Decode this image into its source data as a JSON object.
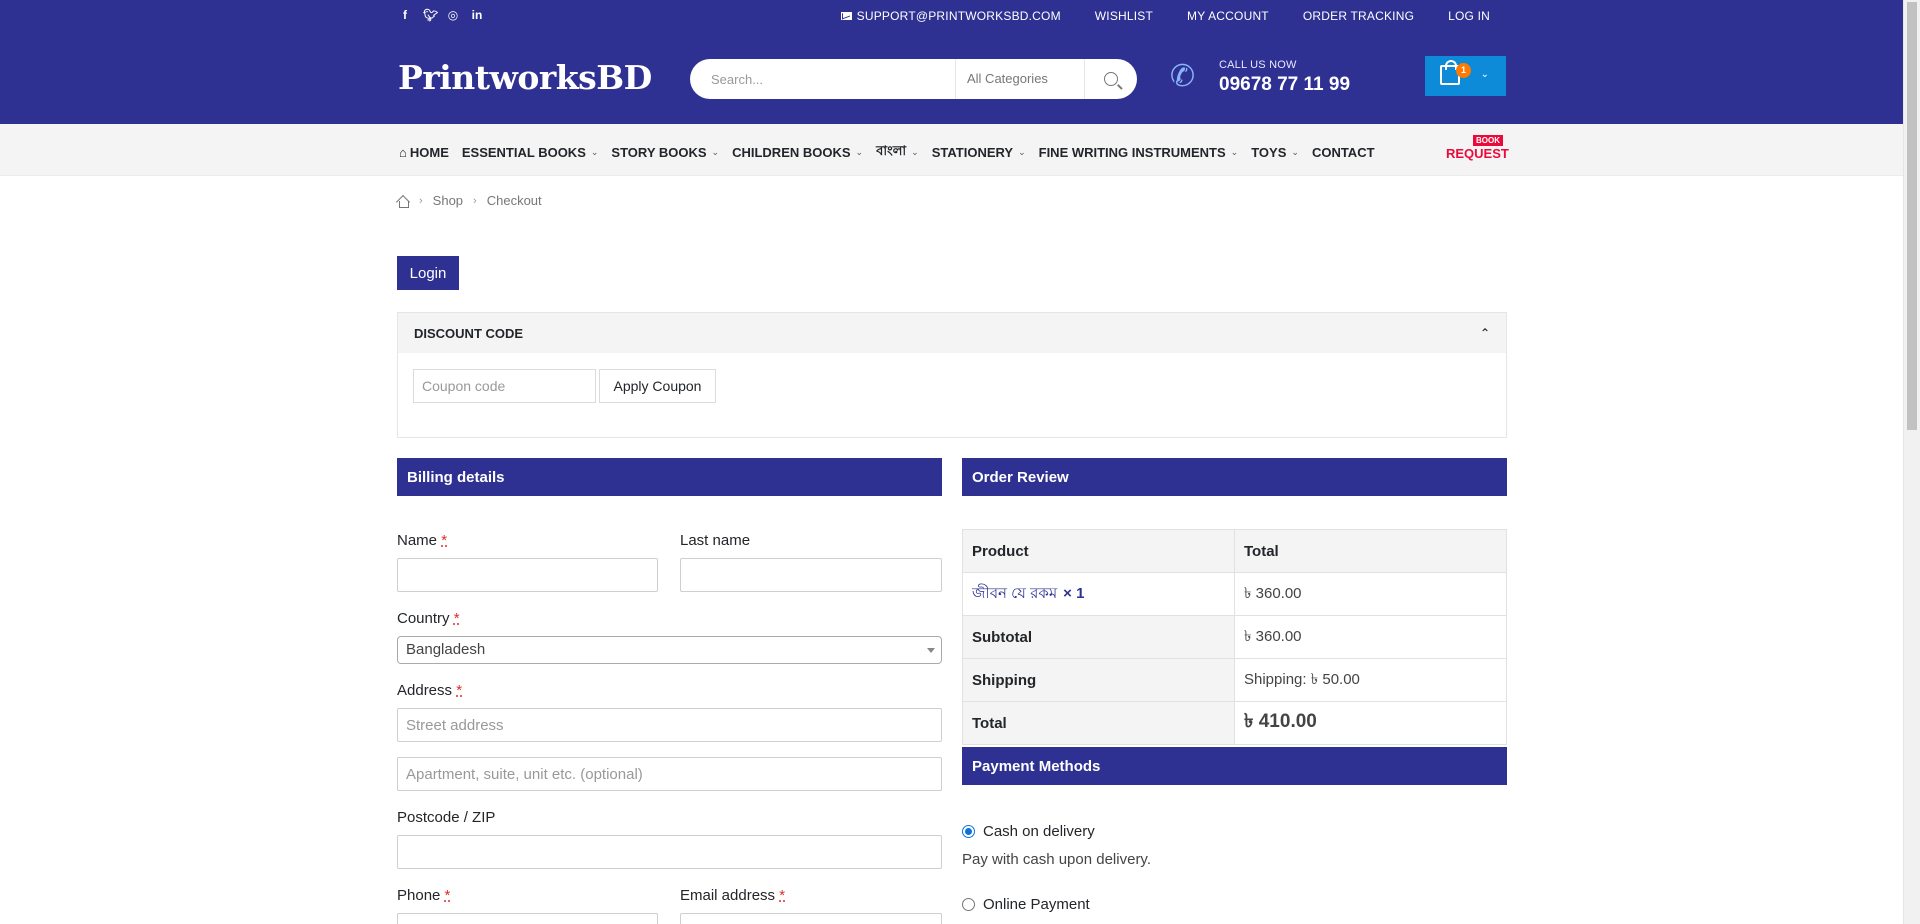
{
  "topbar": {
    "social": [
      "facebook-icon",
      "twitter-icon",
      "instagram-icon",
      "linkedin-icon"
    ],
    "email": "SUPPORT@PRINTWORKSBD.COM",
    "wishlist": "WISHLIST",
    "account": "MY ACCOUNT",
    "tracking": "ORDER TRACKING",
    "login": "LOG IN"
  },
  "header": {
    "logo": "PrintworksBD",
    "search_placeholder": "Search...",
    "category": "All Categories",
    "call_label": "CALL US NOW",
    "call_number": "09678 77 11 99",
    "cart_count": "1"
  },
  "nav": {
    "home": "HOME",
    "essential": "ESSENTIAL BOOKS",
    "story": "STORY BOOKS",
    "children": "CHILDREN BOOKS",
    "bangla": "বাংলা",
    "stationery": "STATIONERY",
    "writing": "FINE WRITING INSTRUMENTS",
    "toys": "TOYS",
    "contact": "CONTACT",
    "request_badge": "BOOK",
    "request": "REQUEST"
  },
  "breadcrumb": {
    "shop": "Shop",
    "checkout": "Checkout"
  },
  "login_button": "Login",
  "discount": {
    "title": "DISCOUNT CODE",
    "placeholder": "Coupon code",
    "apply": "Apply Coupon"
  },
  "billing": {
    "title": "Billing details",
    "name_label": "Name",
    "lastname_label": "Last name",
    "country_label": "Country",
    "country_value": "Bangladesh",
    "address_label": "Address",
    "street_placeholder": "Street address",
    "apt_placeholder": "Apartment, suite, unit etc. (optional)",
    "postcode_label": "Postcode / ZIP",
    "phone_label": "Phone",
    "email_label": "Email address",
    "star": "*"
  },
  "order": {
    "title": "Order Review",
    "col_product": "Product",
    "col_total": "Total",
    "item_name": "জীবন যে রকম",
    "item_qty": "× 1",
    "item_total": "৳ 360.00",
    "subtotal_label": "Subtotal",
    "subtotal": "৳ 360.00",
    "shipping_label": "Shipping",
    "shipping": "Shipping: ৳ 50.00",
    "total_label": "Total",
    "total": "৳ 410.00"
  },
  "payment": {
    "title": "Payment Methods",
    "cod": "Cash on delivery",
    "cod_desc": "Pay with cash upon delivery.",
    "online": "Online Payment"
  },
  "colors": {
    "brand": "#2e3192",
    "cart": "#0d8ad8",
    "accent": "#ea0a3c"
  }
}
